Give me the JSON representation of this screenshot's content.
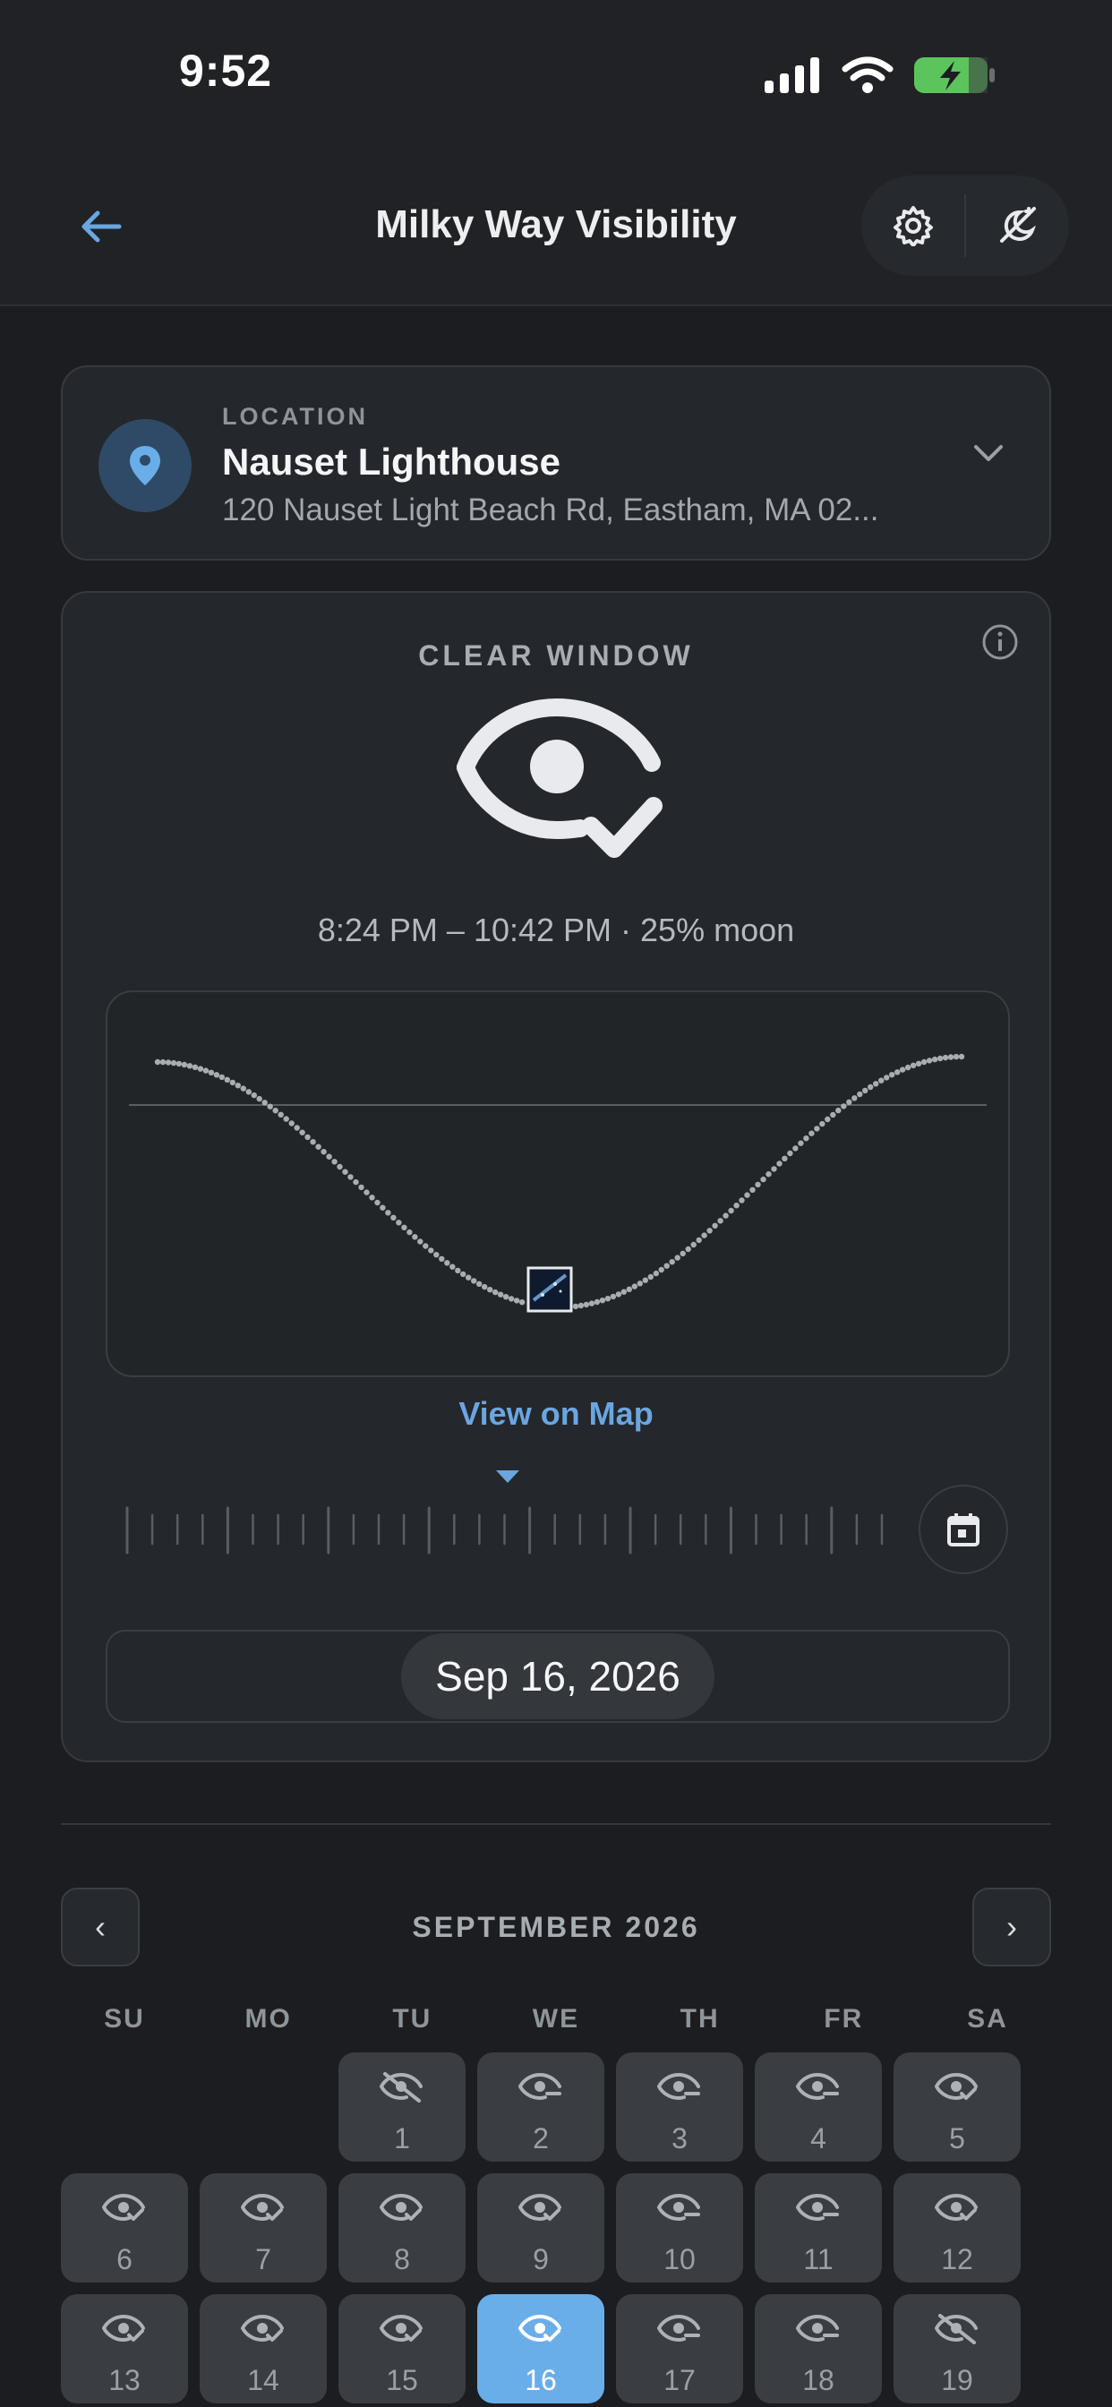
{
  "status": {
    "time": "9:52"
  },
  "nav": {
    "title": "Milky Way Visibility"
  },
  "location": {
    "label": "LOCATION",
    "name": "Nauset Lighthouse",
    "address": "120 Nauset Light Beach Rd, Eastham, MA 02..."
  },
  "clear_window": {
    "title": "CLEAR WINDOW",
    "window_text": "8:24 PM – 10:42 PM · 25% moon",
    "view_map": "View on Map",
    "date": "Sep 16, 2026"
  },
  "calendar": {
    "month": "SEPTEMBER 2026",
    "prev": "‹",
    "next": "›",
    "weekdays": [
      "SU",
      "MO",
      "TU",
      "WE",
      "TH",
      "FR",
      "SA"
    ],
    "days": [
      {
        "n": "1",
        "icon": "eye-off"
      },
      {
        "n": "2",
        "icon": "eye-minus"
      },
      {
        "n": "3",
        "icon": "eye-minus"
      },
      {
        "n": "4",
        "icon": "eye-minus"
      },
      {
        "n": "5",
        "icon": "eye-check"
      },
      {
        "n": "6",
        "icon": "eye-check"
      },
      {
        "n": "7",
        "icon": "eye-check"
      },
      {
        "n": "8",
        "icon": "eye-check"
      },
      {
        "n": "9",
        "icon": "eye-check"
      },
      {
        "n": "10",
        "icon": "eye-minus"
      },
      {
        "n": "11",
        "icon": "eye-minus"
      },
      {
        "n": "12",
        "icon": "eye-check"
      },
      {
        "n": "13",
        "icon": "eye-check"
      },
      {
        "n": "14",
        "icon": "eye-check"
      },
      {
        "n": "15",
        "icon": "eye-check"
      },
      {
        "n": "16",
        "icon": "eye-check",
        "selected": true
      },
      {
        "n": "17",
        "icon": "eye-minus"
      },
      {
        "n": "18",
        "icon": "eye-minus"
      },
      {
        "n": "19",
        "icon": "eye-off"
      }
    ]
  },
  "colors": {
    "accent": "#6aa6e0",
    "selected_day": "#6aaee9",
    "background": "#1b1d20"
  }
}
